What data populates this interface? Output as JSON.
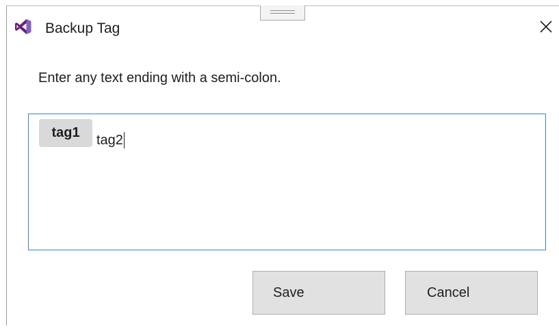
{
  "window": {
    "title": "Backup Tag",
    "app_icon": "visual-studio-icon",
    "close_icon": "close-icon",
    "grip_icon": "resize-grip-icon"
  },
  "instruction": "Enter any text ending with a semi-colon.",
  "tag_input": {
    "tags": [
      "tag1"
    ],
    "current_text": "tag2"
  },
  "buttons": {
    "save_label": "Save",
    "cancel_label": "Cancel"
  },
  "colors": {
    "accent_border": "#3b80cb",
    "vs_purple_dark": "#68217a",
    "vs_purple_light": "#865fc5",
    "tag_background": "#d9d9d9",
    "button_background": "#e1e1e1"
  }
}
